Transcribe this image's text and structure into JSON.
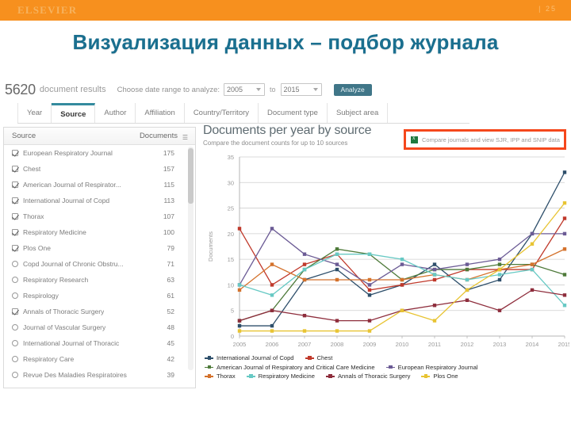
{
  "brand": {
    "name": "ELSEVIER",
    "page_marker": "| 25",
    "bar_color": "#F7901E"
  },
  "slide": {
    "title": "Визуализация данных – подбор журнала",
    "title_color": "#1a6f8f"
  },
  "toolbar": {
    "result_count": "5620",
    "result_label": "document results",
    "daterange_label": "Choose date range to analyze:",
    "year_from": "2005",
    "year_to": "2015",
    "to_label": "to",
    "analyze_label": "Analyze"
  },
  "tabs": [
    {
      "label": "Year",
      "active": false
    },
    {
      "label": "Source",
      "active": true
    },
    {
      "label": "Author",
      "active": false
    },
    {
      "label": "Affiliation",
      "active": false
    },
    {
      "label": "Country/Territory",
      "active": false
    },
    {
      "label": "Document type",
      "active": false
    },
    {
      "label": "Subject area",
      "active": false
    }
  ],
  "source_panel": {
    "col_source": "Source",
    "col_documents": "Documents",
    "sort_icon": "sort-descending-icon",
    "rows": [
      {
        "name": "European Respiratory Journal",
        "count": "175",
        "checked": true
      },
      {
        "name": "Chest",
        "count": "157",
        "checked": true
      },
      {
        "name": "American Journal of Respirator...",
        "count": "115",
        "checked": true
      },
      {
        "name": "International Journal of Copd",
        "count": "113",
        "checked": true
      },
      {
        "name": "Thorax",
        "count": "107",
        "checked": true
      },
      {
        "name": "Respiratory Medicine",
        "count": "100",
        "checked": true
      },
      {
        "name": "Plos One",
        "count": "79",
        "checked": true
      },
      {
        "name": "Copd Journal of Chronic Obstru...",
        "count": "71",
        "checked": false
      },
      {
        "name": "Respiratory Research",
        "count": "63",
        "checked": false
      },
      {
        "name": "Respirology",
        "count": "61",
        "checked": false
      },
      {
        "name": "Annals of Thoracic Surgery",
        "count": "52",
        "checked": true
      },
      {
        "name": "Journal of Vascular Surgery",
        "count": "48",
        "checked": false
      },
      {
        "name": "International Journal of Thoracic",
        "count": "45",
        "checked": false
      },
      {
        "name": "Respiratory Care",
        "count": "42",
        "checked": false
      },
      {
        "name": "Revue Des Maladies Respiratoires",
        "count": "39",
        "checked": false
      }
    ]
  },
  "chart_header": {
    "title": "Documents per year by source",
    "subtitle": "Compare the document counts for up to 10 sources",
    "compare_link": "Compare journals and view SJR, IPP and SNIP data",
    "compare_icon": "excel-icon",
    "highlight_color": "#F5471C"
  },
  "chart_data": {
    "type": "line",
    "title": "Documents per year by source",
    "xlabel": "",
    "ylabel": "Documents",
    "x": [
      "2005",
      "2006",
      "2007",
      "2008",
      "2009",
      "2010",
      "2011",
      "2012",
      "2013",
      "2014",
      "2015"
    ],
    "ylim": [
      0,
      35
    ],
    "yticks": [
      0,
      5,
      10,
      15,
      20,
      25,
      30,
      35
    ],
    "grid": true,
    "legend_position": "bottom",
    "series": [
      {
        "name": "International Journal of Copd",
        "color": "#2e4f6b",
        "values": [
          2,
          2,
          11,
          13,
          8,
          10,
          14,
          9,
          11,
          20,
          32
        ]
      },
      {
        "name": "Chest",
        "color": "#c0392b",
        "values": [
          21,
          10,
          14,
          16,
          9,
          10,
          11,
          13,
          13,
          13,
          23
        ]
      },
      {
        "name": "American Journal of Respiratory and Critical Care Medicine",
        "color": "#4e7a3a",
        "values": [
          3,
          5,
          13,
          17,
          16,
          11,
          13,
          13,
          14,
          14,
          12
        ]
      },
      {
        "name": "European Respiratory Journal",
        "color": "#6b5b95",
        "values": [
          10,
          21,
          16,
          14,
          10,
          14,
          13,
          14,
          15,
          20,
          20
        ]
      },
      {
        "name": "Thorax",
        "color": "#d4722c",
        "values": [
          9,
          14,
          11,
          11,
          11,
          11,
          12,
          11,
          13,
          14,
          17
        ]
      },
      {
        "name": "Respiratory Medicine",
        "color": "#67c9c4",
        "values": [
          10,
          8,
          13,
          16,
          16,
          15,
          12,
          11,
          12,
          13,
          6
        ]
      },
      {
        "name": "Annals of Thoracic Surgery",
        "color": "#8e2d3c",
        "values": [
          3,
          5,
          4,
          3,
          3,
          5,
          6,
          7,
          5,
          9,
          8
        ]
      },
      {
        "name": "Plos One",
        "color": "#e8c433",
        "values": [
          1,
          1,
          1,
          1,
          1,
          5,
          3,
          9,
          13,
          18,
          26
        ]
      }
    ]
  }
}
